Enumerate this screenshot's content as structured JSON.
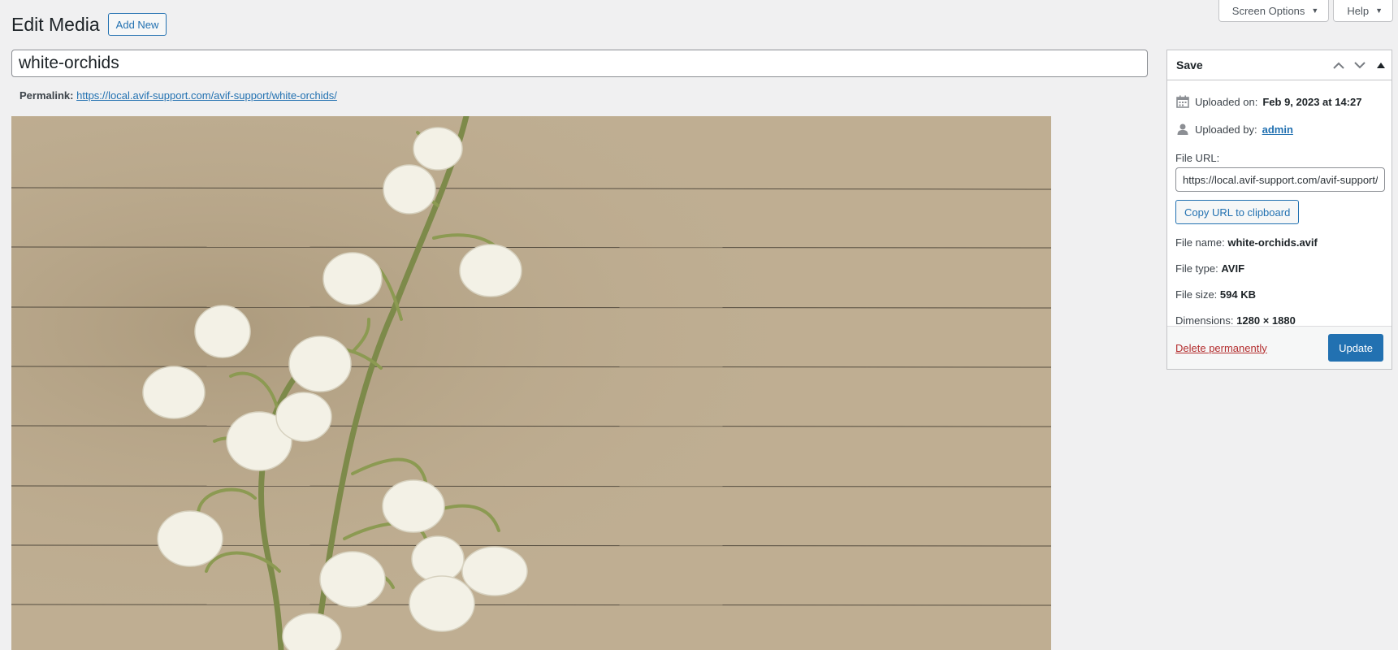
{
  "screen_meta": {
    "screen_options_label": "Screen Options",
    "help_label": "Help"
  },
  "header": {
    "title": "Edit Media",
    "add_new_label": "Add New"
  },
  "post": {
    "title_value": "white-orchids",
    "permalink_label": "Permalink:",
    "permalink_url": "https://local.avif-support.com/avif-support/white-orchids/"
  },
  "save_box": {
    "title": "Save",
    "uploaded_on_label": "Uploaded on:",
    "uploaded_on_value": "Feb 9, 2023 at 14:27",
    "uploaded_by_label": "Uploaded by:",
    "uploaded_by_value": "admin",
    "file_url_label": "File URL:",
    "file_url_value": "https://local.avif-support.com/avif-support/white-orchids.avif",
    "copy_button_label": "Copy URL to clipboard",
    "file_name_label": "File name:",
    "file_name_value": "white-orchids.avif",
    "file_type_label": "File type:",
    "file_type_value": "AVIF",
    "file_size_label": "File size:",
    "file_size_value": "594 KB",
    "dimensions_label": "Dimensions:",
    "dimensions_value": "1280 × 1880",
    "delete_label": "Delete permanently",
    "update_label": "Update"
  },
  "icons": {
    "calendar": "calendar-icon",
    "user": "user-icon",
    "move_up": "chevron-up-icon",
    "move_down": "chevron-down-icon",
    "toggle": "triangle-up-icon"
  },
  "colors": {
    "accent": "#2271b1",
    "danger": "#b32d2e",
    "paper": "#bfae92"
  }
}
